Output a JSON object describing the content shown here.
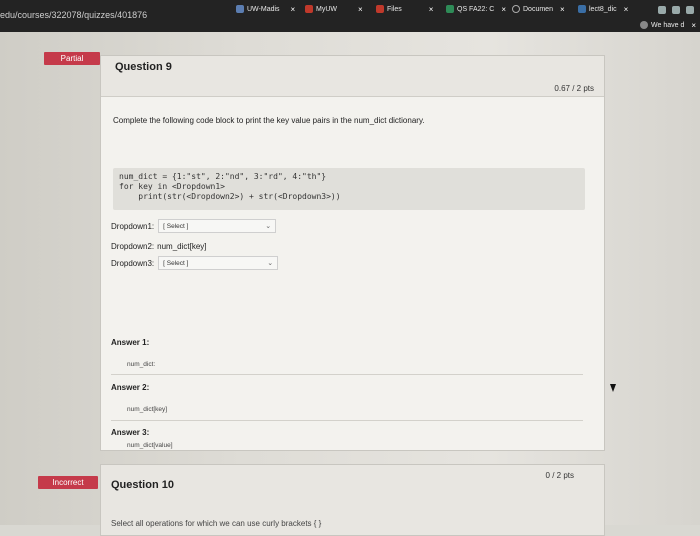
{
  "browser": {
    "url": "edu/courses/322078/quizzes/401876",
    "tabs": [
      {
        "label": "UW-Madis",
        "color": "#5b7db1"
      },
      {
        "label": "MyUW",
        "color": "#c0392b"
      },
      {
        "label": "Files",
        "color": "#c0392b"
      },
      {
        "label": "QS FA22: C",
        "color": "#2e8b57"
      },
      {
        "label": "Documen",
        "color": "#777777"
      },
      {
        "label": "lect8_dic",
        "color": "#3a6ea5"
      },
      {
        "label": "We have d",
        "color": "#888888"
      }
    ],
    "close_glyph": "×"
  },
  "question9": {
    "badge": "Partial",
    "title": "Question 9",
    "points": "0.67 / 2 pts",
    "prompt": "Complete the following code block to print the key value pairs in the num_dict dictionary.",
    "code": [
      "num_dict = {1:\"st\", 2:\"nd\", 3:\"rd\", 4:\"th\"}",
      "for key in <Dropdown1>",
      "    print(str(<Dropdown2>) + str(<Dropdown3>))"
    ],
    "dropdown1": {
      "label": "Dropdown1:",
      "value": "[ Select ]"
    },
    "dropdown2": {
      "label": "Dropdown2:",
      "value": "num_dict[key]"
    },
    "dropdown3": {
      "label": "Dropdown3:",
      "value": "[ Select ]"
    },
    "answers": [
      {
        "label": "Answer 1:",
        "value": "num_dict:"
      },
      {
        "label": "Answer 2:",
        "value": "num_dict[key]"
      },
      {
        "label": "Answer 3:",
        "value": "num_dict[value]"
      }
    ]
  },
  "question10": {
    "badge": "Incorrect",
    "title": "Question 10",
    "points": "0 / 2 pts",
    "prompt": "Select all operations for which we can use curly brackets { }"
  },
  "colors": {
    "badge_red": "#c53a4a",
    "page_bg": "#e6e4df",
    "topbar": "#232323"
  }
}
